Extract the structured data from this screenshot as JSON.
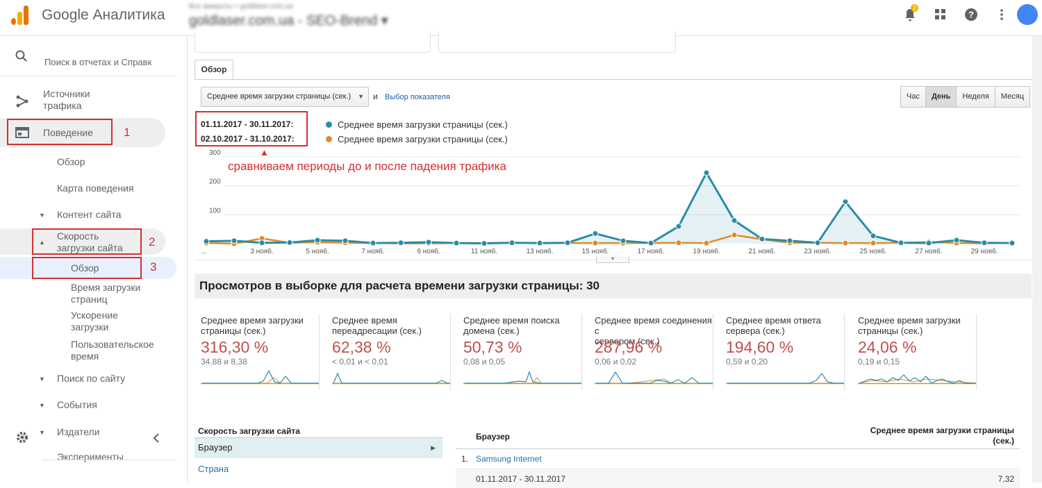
{
  "header": {
    "app_title": "Google Аналитика",
    "account_path": "Все аккаунты > goldlaser.com.ua",
    "account_name": "goldlaser.com.ua - SEO-Brend ▾",
    "notification_count": "2"
  },
  "sidebar": {
    "search_placeholder": "Поиск в отчетах и Справк",
    "items": [
      {
        "label": "Источники\nтрафика"
      },
      {
        "label": "Поведение",
        "annotation": "1"
      },
      {
        "label": "Обзор"
      },
      {
        "label": "Карта поведения"
      },
      {
        "label": "Контент сайта"
      },
      {
        "label": "Скорость\nзагрузки сайта",
        "annotation": "2"
      },
      {
        "label": "Обзор",
        "annotation": "3"
      },
      {
        "label": "Время загрузки\nстраниц"
      },
      {
        "label": "Ускорение\nзагрузки"
      },
      {
        "label": "Пользовательское\nвремя"
      },
      {
        "label": "Поиск по сайту"
      },
      {
        "label": "События"
      },
      {
        "label": "Издатели"
      },
      {
        "label": "Эксперименты"
      }
    ]
  },
  "tabs": {
    "overview": "Обзор"
  },
  "toolbar": {
    "metric_select": "Среднее время загрузки страницы (сек.)",
    "and": "и",
    "choose_metric": "Выбор показателя",
    "periods": [
      "Час",
      "День",
      "Неделя",
      "Месяц"
    ],
    "active_period": "День"
  },
  "comparison": {
    "period1": "01.11.2017 - 30.11.2017:",
    "period2": "02.10.2017 - 31.10.2017:",
    "series1_label": "Среднее время загрузки страницы (сек.)",
    "series2_label": "Среднее время загрузки страницы (сек.)",
    "annotation": "сравниваем периоды до и после падения трафика"
  },
  "colors": {
    "series1": "#2a8ca8",
    "series2": "#e08a2a",
    "highlight": "#d32f2f",
    "negative": "#c0504d"
  },
  "chart_data": {
    "type": "line",
    "x": [
      "1 нояб.",
      "2 нояб.",
      "3 нояб.",
      "4 нояб.",
      "5 нояб.",
      "6 нояб.",
      "7 нояб.",
      "8 нояб.",
      "9 нояб.",
      "10 нояб.",
      "11 нояб.",
      "12 нояб.",
      "13 нояб.",
      "14 нояб.",
      "15 нояб.",
      "16 нояб.",
      "17 нояб.",
      "18 нояб.",
      "19 нояб.",
      "20 нояб.",
      "21 нояб.",
      "22 нояб.",
      "23 нояб.",
      "24 нояб.",
      "25 нояб.",
      "26 нояб.",
      "27 нояб.",
      "28 нояб.",
      "29 нояб.",
      "30 нояб."
    ],
    "x_tick_labels": [
      "...",
      "3 нояб.",
      "5 нояб.",
      "7 нояб.",
      "9 нояб.",
      "11 нояб.",
      "13 нояб.",
      "15 нояб.",
      "17 нояб.",
      "19 нояб.",
      "21 нояб.",
      "23 нояб.",
      "25 нояб.",
      "27 нояб.",
      "29 нояб."
    ],
    "yticks": [
      100,
      200,
      300
    ],
    "ylim": [
      0,
      300
    ],
    "series": [
      {
        "name": "01.11.2017 - 30.11.2017",
        "values": [
          8,
          10,
          3,
          4,
          12,
          10,
          2,
          3,
          5,
          2,
          1,
          3,
          2,
          3,
          35,
          10,
          2,
          60,
          245,
          80,
          16,
          10,
          3,
          145,
          27,
          3,
          2,
          12,
          3,
          2
        ]
      },
      {
        "name": "02.10.2017 - 31.10.2017",
        "values": [
          2,
          0,
          18,
          3,
          5,
          3,
          2,
          1,
          1,
          2,
          2,
          4,
          1,
          2,
          2,
          2,
          2,
          3,
          2,
          30,
          15,
          3,
          3,
          2,
          2,
          3,
          6,
          2,
          1,
          3
        ]
      }
    ]
  },
  "sample_title": "Просмотров в выборке для расчета времени загрузки страницы: 30",
  "tiles": [
    {
      "label": "Среднее время загрузки\nстраницы (сек.)",
      "value": "316,30 %",
      "sub": "34,88 и 8,38"
    },
    {
      "label": "Среднее время\nпереадресации (сек.)",
      "value": "62,38 %",
      "sub": "< 0,01 и < 0,01"
    },
    {
      "label": "Среднее время поиска\nдомена (сек.)",
      "value": "50,73 %",
      "sub": "0,08 и 0,05"
    },
    {
      "label": "Среднее время соединения с\nсервером (сек.)",
      "value": "287,96 %",
      "sub": "0,06 и 0,02"
    },
    {
      "label": "Среднее время ответа\nсервера (сек.)",
      "value": "194,60 %",
      "sub": "0,59 и 0,20"
    },
    {
      "label": "Среднее время загрузки\nстраницы (сек.)",
      "value": "24,06 %",
      "sub": "0,19 и 0,15"
    }
  ],
  "left_table": {
    "header": "Скорость загрузки сайта",
    "rows": [
      "Браузер",
      "Страна"
    ]
  },
  "right_table": {
    "col1": "Браузер",
    "col2": "Среднее время загрузки страницы\n(сек.)",
    "row_num": "1.",
    "row_name": "Samsung Internet",
    "sub_period": "01.11.2017 - 30.11.2017",
    "sub_value": "7,32"
  }
}
